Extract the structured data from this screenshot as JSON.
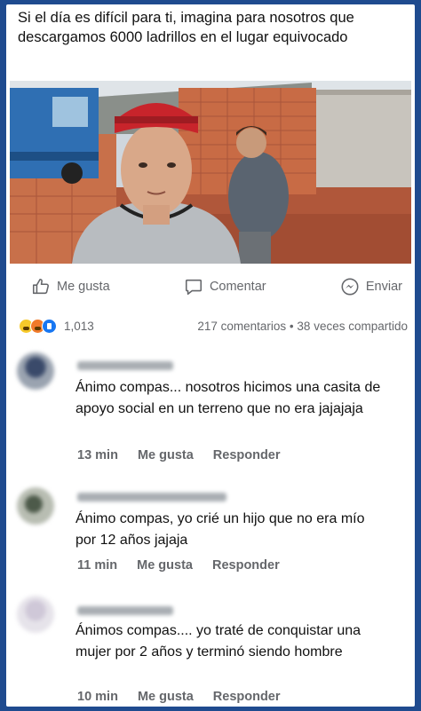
{
  "post": {
    "caption": "Si el día es difícil para ti, imagina para nosotros que descargamos 6000 ladrillos en el lugar equivocado"
  },
  "actions": {
    "like": "Me gusta",
    "comment": "Comentar",
    "send": "Enviar"
  },
  "stats": {
    "reactions_count": "1,013",
    "comments": "217 comentarios",
    "dot": "•",
    "shares": "38 veces compartido"
  },
  "comments": [
    {
      "text": "Ánimo compas... nosotros hicimos una casita de apoyo social en un terreno que no era jajajaja",
      "time": "13 min",
      "like": "Me gusta",
      "reply": "Responder"
    },
    {
      "text": "Ánimo compas, yo crié un hijo que no era mío por 12 años jajaja",
      "time": "11 min",
      "like": "Me gusta",
      "reply": "Responder"
    },
    {
      "text": "Ánimos compas.... yo traté de conquistar una mujer por 2 años y terminó siendo hombre",
      "time": "10 min",
      "like": "Me gusta",
      "reply": "Responder"
    }
  ],
  "colors": {
    "frame": "#1f4b8f",
    "meta_text": "#65676b",
    "like_blue": "#1877f2"
  }
}
